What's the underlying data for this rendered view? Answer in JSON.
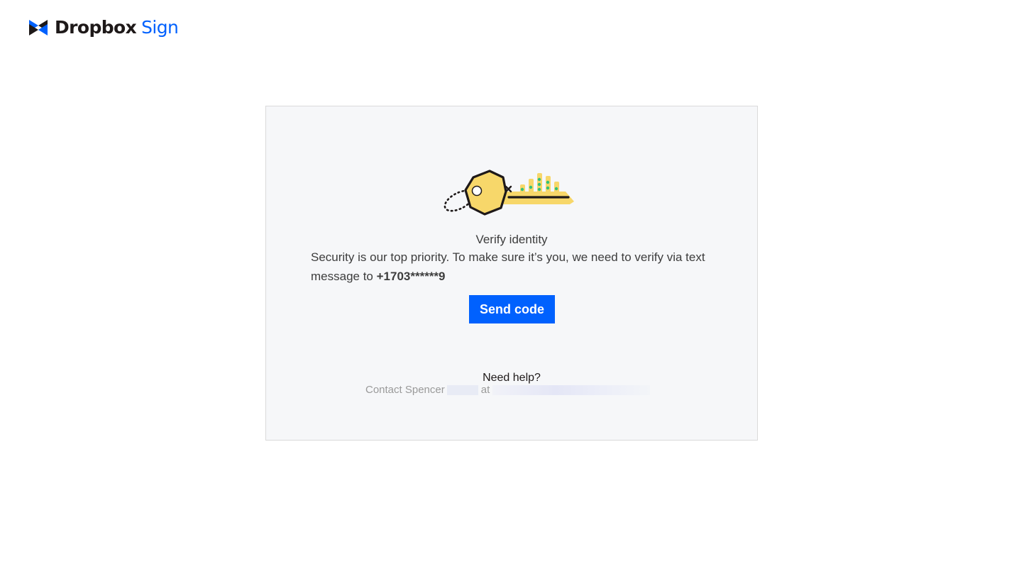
{
  "brand": {
    "word_1": "Dropbox",
    "word_2": "Sign",
    "accent_color": "#0061fe",
    "mark_icon": "dropbox-sign-logo-icon"
  },
  "card": {
    "illustration": "key-icon",
    "title": "Verify identity",
    "message_prefix": "Security is our top priority. To make sure it’s you, we need to verify via text message to ",
    "phone_masked": "+1703******9",
    "send_button_label": "Send code",
    "help_title": "Need help?",
    "help_contact_prefix": "Contact Spencer",
    "help_contact_mid": "at"
  }
}
